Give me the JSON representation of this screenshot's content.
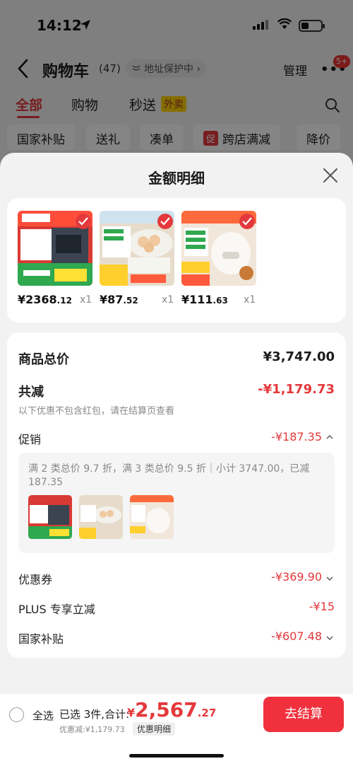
{
  "status_bar": {
    "time": "14:12"
  },
  "navbar": {
    "title": "购物车",
    "count": "(47)",
    "address_protect": "地址保护中 ›",
    "manage": "管理",
    "more": "•••",
    "badge": "5+"
  },
  "tabs": [
    {
      "label": "全部"
    },
    {
      "label": "购物"
    },
    {
      "label": "秒送"
    }
  ],
  "tab_flash_tag": "外卖",
  "chips": [
    "国家补贴",
    "送礼",
    "凑单",
    "跨店满减",
    "降价"
  ],
  "chip_promo_tag": "促",
  "sheet": {
    "title": "金额明细",
    "products": [
      {
        "price_main": "¥2368",
        "price_dec": ".12",
        "qty": "x1"
      },
      {
        "price_main": "¥87",
        "price_dec": ".52",
        "qty": "x1"
      },
      {
        "price_main": "¥111",
        "price_dec": ".63",
        "qty": "x1"
      }
    ],
    "goods_total_label": "商品总价",
    "goods_total_value": "¥3,747.00",
    "total_reduce_label": "共减",
    "total_reduce_value": "-¥1,179.73",
    "total_reduce_note": "以下优惠不包含红包，请在结算页查看",
    "promo_label": "促销",
    "promo_value": "-¥187.35",
    "promo_desc": "满 2 类总价 9.7 折，满 3 类总价 9.5 折｜小计 3747.00，已减 187.35",
    "coupon_label": "优惠券",
    "coupon_value": "-¥369.90",
    "plus_label": "PLUS 专享立减",
    "plus_value": "-¥15",
    "subsidy_label": "国家补贴",
    "subsidy_value": "-¥607.48"
  },
  "bottom_bar": {
    "select_all": "全选",
    "selected_text": "已选 3件,合计:",
    "total_symbol": "¥",
    "total_int": "2,567",
    "total_dec": ".27",
    "discount_text": "优惠减:¥1,179.73",
    "detail_button": "优惠明细",
    "checkout": "去结算"
  },
  "colors": {
    "accent": "#e4393c",
    "checkout": "#f0313d"
  },
  "icons": [
    "location-arrow-icon",
    "signal-icon",
    "wifi-icon",
    "battery-icon",
    "back-chevron-icon",
    "shield-icon",
    "search-icon",
    "close-icon",
    "check-icon",
    "chevron-up-icon",
    "chevron-down-icon"
  ]
}
